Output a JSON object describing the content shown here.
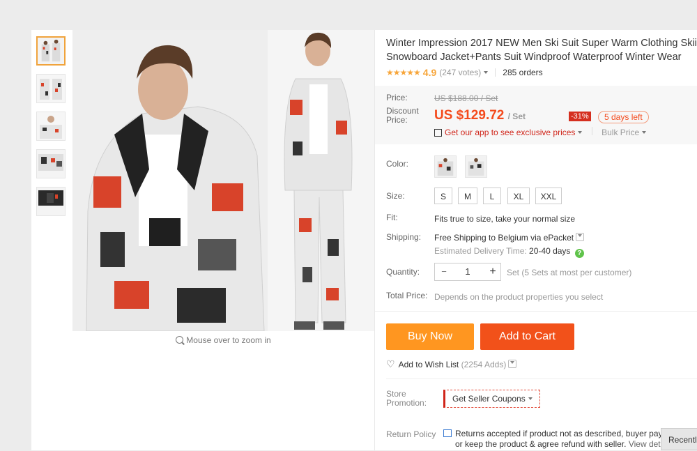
{
  "product": {
    "title_line1": "Winter Impression 2017 NEW Men Ski Suit Super Warm Clothing Skiin",
    "title_line2": "Snowboard Jacket+Pants Suit Windproof Waterproof Winter Wear",
    "stars": "★★★★★",
    "rating": "4.9",
    "votes": "(247 votes)",
    "orders": "285 orders"
  },
  "price": {
    "price_label": "Price:",
    "old_price": "US $188.00 / Set",
    "discount_label_1": "Discount",
    "discount_label_2": "Price:",
    "current_price": "US $129.72",
    "unit": "/ Set",
    "off_badge": "-31%",
    "days_left": "5 days left",
    "app_promo": "Get our app to see exclusive prices",
    "bulk_price": "Bulk Price"
  },
  "options": {
    "color_label": "Color:",
    "size_label": "Size:",
    "sizes": [
      "S",
      "M",
      "L",
      "XL",
      "XXL"
    ],
    "fit_label": "Fit:",
    "fit_value": "Fits true to size, take your normal size",
    "shipping_label": "Shipping:",
    "shipping_value": "Free Shipping to Belgium via ePacket",
    "delivery_prefix": "Estimated Delivery Time:",
    "delivery_days": "20-40 days",
    "help": "?",
    "quantity_label": "Quantity:",
    "qty_minus": "−",
    "qty_value": "1",
    "qty_plus": "+",
    "qty_note": "Set (5 Sets at most per customer)",
    "total_label": "Total Price:",
    "total_value": "Depends on the product properties you select"
  },
  "actions": {
    "buy_now": "Buy Now",
    "add_to_cart": "Add to Cart",
    "wish_icon": "♡",
    "wish_label": "Add to Wish List",
    "wish_count": "(2254 Adds)"
  },
  "store": {
    "promo_label_1": "Store",
    "promo_label_2": "Promotion:",
    "coupon": "Get Seller Coupons",
    "return_label": "Return Policy",
    "return_line1": "Returns accepted if product not as described, buyer pays",
    "return_line2": "or keep the product & agree refund with seller.",
    "view_details": "View deta"
  },
  "gallery": {
    "zoom_hint": "Mouse over to zoom in"
  },
  "recently": "Recentl",
  "colors": {
    "accent_orange": "#ff9620",
    "cart_red": "#f2511a",
    "price_red": "#f44a1c",
    "star": "#f7a63b"
  }
}
